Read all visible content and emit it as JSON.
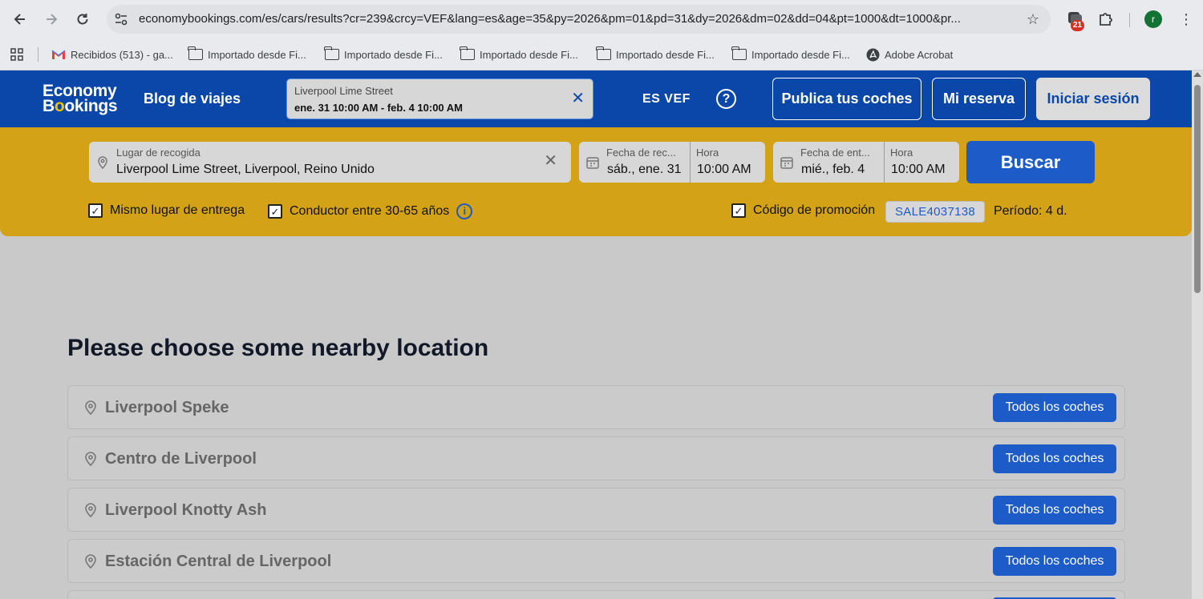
{
  "browser": {
    "url": "economybookings.com/es/cars/results?cr=239&crcy=VEF&lang=es&age=35&py=2026&pm=01&pd=31&dy=2026&dm=02&dd=04&pt=1000&dt=1000&pr...",
    "extension_badge": "21",
    "profile_initial": "r",
    "bookmarks": [
      {
        "label": "Recibidos (513) - ga...",
        "icon": "gmail-icon"
      },
      {
        "label": "Importado desde Fi...",
        "icon": "folder-icon"
      },
      {
        "label": "Importado desde Fi...",
        "icon": "folder-icon"
      },
      {
        "label": "Importado desde Fi...",
        "icon": "folder-icon"
      },
      {
        "label": "Importado desde Fi...",
        "icon": "folder-icon"
      },
      {
        "label": "Importado desde Fi...",
        "icon": "folder-icon"
      },
      {
        "label": "Adobe Acrobat",
        "icon": "acrobat-icon"
      }
    ]
  },
  "header": {
    "logo_line1": "Economy",
    "logo_line2_a": "B",
    "logo_line2_o": "o",
    "logo_line2_b": "okings",
    "blog_label": "Blog de viajes",
    "summary_location": "Liverpool Lime Street",
    "summary_dates": "ene. 31 10:00 AM - feb. 4 10:00 AM",
    "language": "ES",
    "currency": "VEF",
    "publish_label": "Publica tus coches",
    "booking_label": "Mi reserva",
    "login_label": "Iniciar sesión",
    "brand_color": "#0a47a8",
    "accent_color": "#f5c400"
  },
  "search": {
    "pickup_label": "Lugar de recogida",
    "pickup_value": "Liverpool Lime Street, Liverpool, Reino Unido",
    "pickup_date_label": "Fecha de rec...",
    "pickup_date_value": "sáb., ene. 31",
    "pickup_time_label": "Hora",
    "pickup_time_value": "10:00 AM",
    "return_date_label": "Fecha de ent...",
    "return_date_value": "mié., feb. 4",
    "return_time_label": "Hora",
    "return_time_value": "10:00 AM",
    "search_button": "Buscar",
    "same_location_label": "Mismo lugar de entrega",
    "driver_age_label": "Conductor entre 30-65 años",
    "promo_label": "Código de promoción",
    "promo_code": "SALE4037138",
    "period_label": "Período: 4 d.",
    "band_color": "#d4a216"
  },
  "main": {
    "title": "Please choose some nearby location",
    "locations": [
      {
        "name": "Liverpool Speke",
        "button": "Todos los coches"
      },
      {
        "name": "Centro de Liverpool",
        "button": "Todos los coches"
      },
      {
        "name": "Liverpool Knotty Ash",
        "button": "Todos los coches"
      },
      {
        "name": "Estación Central de Liverpool",
        "button": "Todos los coches"
      }
    ]
  }
}
